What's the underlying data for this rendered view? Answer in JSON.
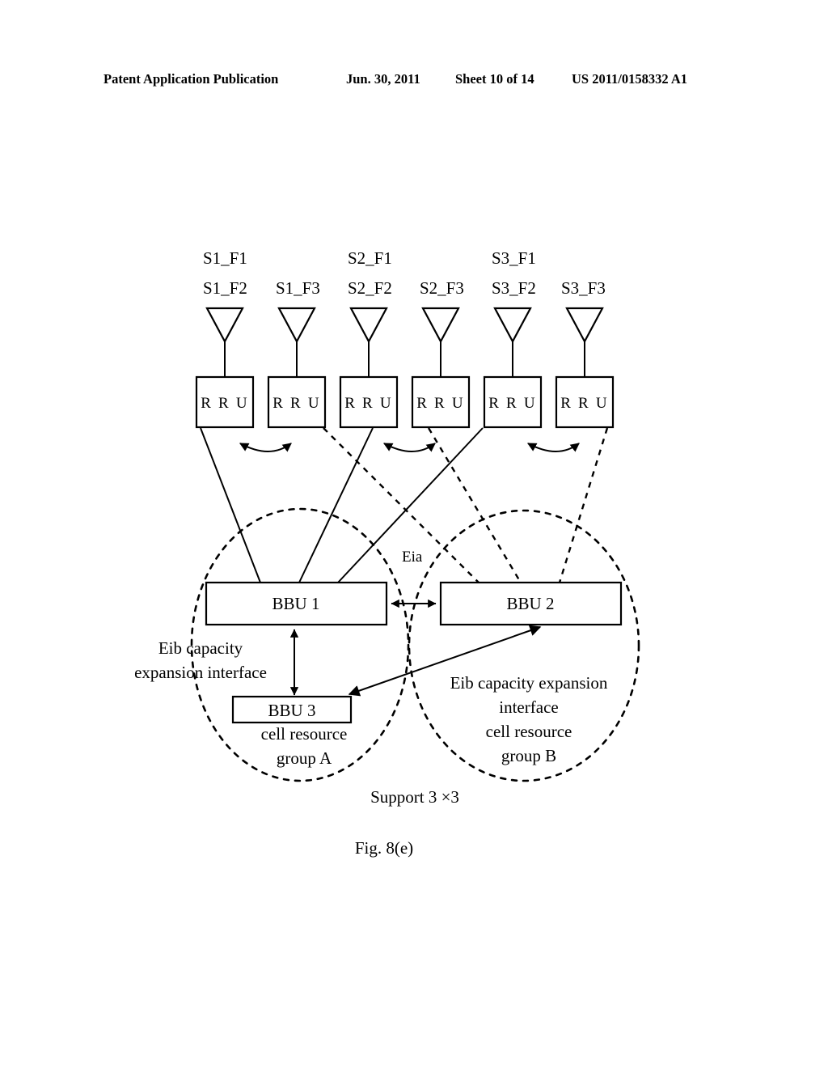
{
  "header": {
    "publication": "Patent Application Publication",
    "date": "Jun. 30, 2011",
    "sheet": "Sheet 10 of 14",
    "number": "US 2011/0158332 A1"
  },
  "figure": {
    "caption": "Fig. 8(e)",
    "support_note": "Support  3 ×3",
    "antenna_labels_row1": [
      "S1_F1",
      "S2_F1",
      "S3_F1"
    ],
    "antenna_labels_row2": [
      "S1_F2",
      "S1_F3",
      "S2_F2",
      "S2_F3",
      "S3_F2",
      "S3_F3"
    ],
    "rru_label": "R R U",
    "rru_count": 6,
    "bbu1": "BBU 1",
    "bbu2": "BBU 2",
    "bbu3": "BBU 3",
    "eia_label": "Eia",
    "eib_left_line1": "Eib capacity",
    "eib_left_line2": "expansion interface",
    "group_a_line1": "cell resource",
    "group_a_line2": "group A",
    "eib_right_line1": "Eib capacity expansion",
    "eib_right_line2": "interface",
    "group_b_line1": "cell resource",
    "group_b_line2": "group B"
  },
  "colors": {
    "ink": "#000000",
    "paper": "#ffffff"
  }
}
